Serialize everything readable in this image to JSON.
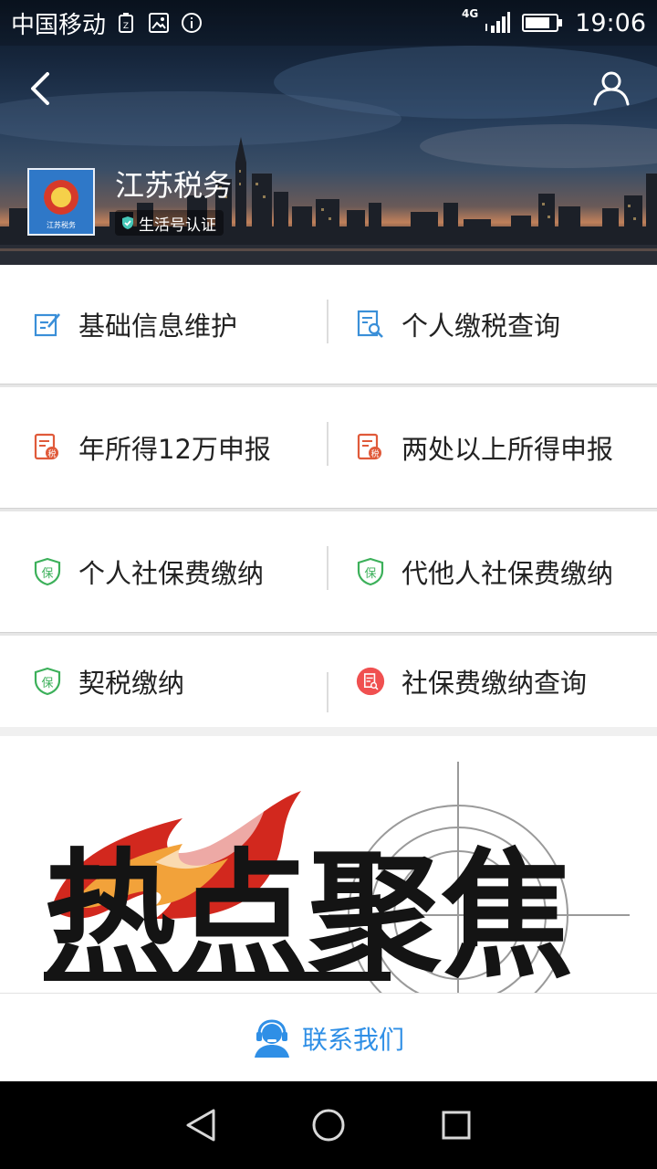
{
  "status_bar": {
    "carrier": "中国移动",
    "network": "4G",
    "time": "19:06"
  },
  "header": {
    "account_name": "江苏税务",
    "verify_badge": "生活号认证",
    "logo_text": "江苏税务"
  },
  "menu": {
    "rows": [
      [
        {
          "label": "基础信息维护",
          "icon": "edit-icon",
          "color": "#3a8fd8"
        },
        {
          "label": "个人缴税查询",
          "icon": "search-doc-icon",
          "color": "#3a8fd8"
        }
      ],
      [
        {
          "label": "年所得12万申报",
          "icon": "tax-doc-icon",
          "color": "#e05a3a"
        },
        {
          "label": "两处以上所得申报",
          "icon": "tax-doc-icon",
          "color": "#e05a3a"
        }
      ],
      [
        {
          "label": "个人社保费缴纳",
          "icon": "shield-bao-icon",
          "color": "#3cb05a"
        },
        {
          "label": "代他人社保费缴纳",
          "icon": "shield-bao-icon",
          "color": "#3cb05a"
        }
      ],
      [
        {
          "label": "契税缴纳",
          "icon": "shield-bao-icon",
          "color": "#3cb05a"
        },
        {
          "label": "社保费缴纳查询",
          "icon": "query-badge-icon",
          "color": "#f05050"
        }
      ]
    ]
  },
  "banner": {
    "text": "热点聚焦"
  },
  "contact": {
    "label": "联系我们",
    "color": "#2f8fe6"
  }
}
